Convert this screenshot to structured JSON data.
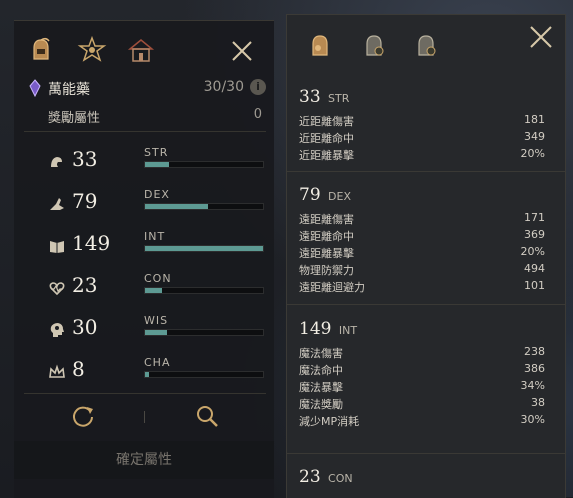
{
  "top_strip": "",
  "left_panel": {
    "tabs": [
      {
        "icon": "helmet-icon"
      },
      {
        "icon": "star-icon"
      },
      {
        "icon": "house-icon"
      }
    ],
    "potion": {
      "name": "萬能藥",
      "count": "30/30",
      "info": "i"
    },
    "bonus": {
      "label": "獎勵屬性",
      "value": "0"
    },
    "stats": [
      {
        "abbr": "STR",
        "value": "33",
        "level": 0.2
      },
      {
        "abbr": "DEX",
        "value": "79",
        "level": 0.53
      },
      {
        "abbr": "INT",
        "value": "149",
        "level": 1.0
      },
      {
        "abbr": "CON",
        "value": "23",
        "level": 0.14
      },
      {
        "abbr": "WIS",
        "value": "30",
        "level": 0.19
      },
      {
        "abbr": "CHA",
        "value": "8",
        "level": 0.03
      }
    ],
    "confirm_label": "確定屬性"
  },
  "right_panel": {
    "groups": [
      {
        "value": "33",
        "abbr": "STR",
        "lines": [
          {
            "label": "近距離傷害",
            "value": "181"
          },
          {
            "label": "近距離命中",
            "value": "349"
          },
          {
            "label": "近距離暴擊",
            "value": "20%"
          }
        ]
      },
      {
        "value": "79",
        "abbr": "DEX",
        "lines": [
          {
            "label": "遠距離傷害",
            "value": "171"
          },
          {
            "label": "遠距離命中",
            "value": "369"
          },
          {
            "label": "遠距離暴擊",
            "value": "20%"
          },
          {
            "label": "物理防禦力",
            "value": "494"
          },
          {
            "label": "遠距離迴避力",
            "value": "101"
          }
        ]
      },
      {
        "value": "149",
        "abbr": "INT",
        "lines": [
          {
            "label": "魔法傷害",
            "value": "238"
          },
          {
            "label": "魔法命中",
            "value": "386"
          },
          {
            "label": "魔法暴擊",
            "value": "34%"
          },
          {
            "label": "魔法獎勵",
            "value": "38"
          },
          {
            "label": "減少MP消耗",
            "value": "30%"
          }
        ]
      },
      {
        "value": "23",
        "abbr": "CON",
        "lines": []
      }
    ]
  },
  "colors": {
    "bar_fill": "#5d9a93",
    "gold": "#c9a66b"
  }
}
